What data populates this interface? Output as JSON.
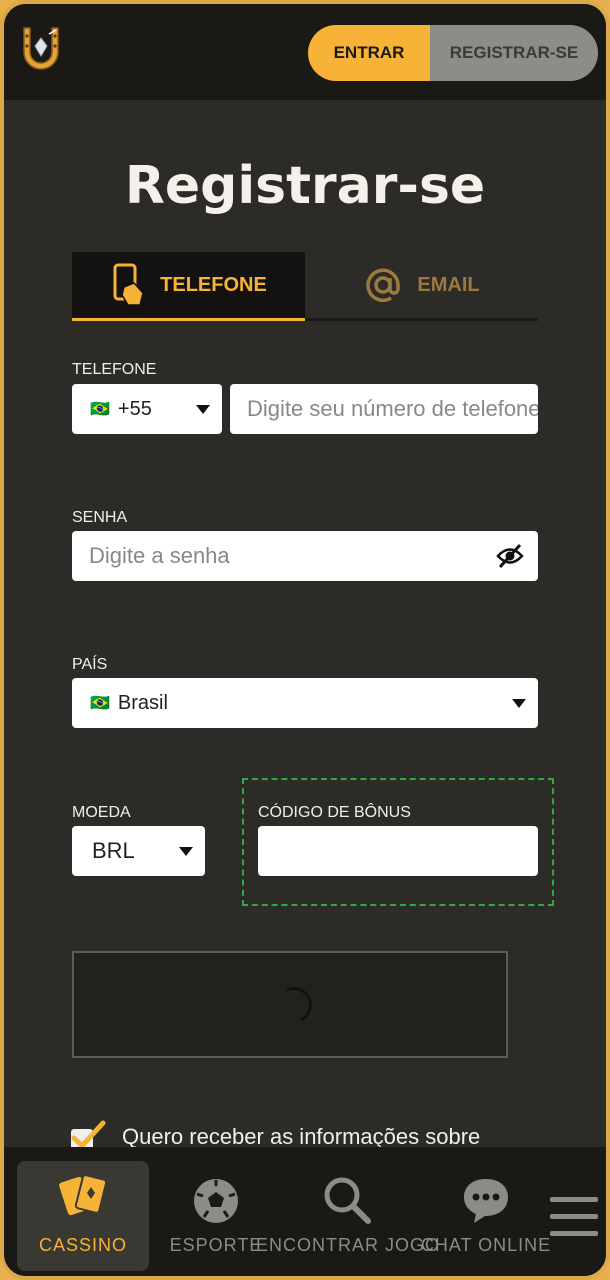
{
  "header": {
    "login_label": "ENTRAR",
    "register_label": "REGISTRAR-SE"
  },
  "page": {
    "title": "Registrar-se"
  },
  "tabs": [
    {
      "label": "TELEFONE",
      "icon": "phone-icon",
      "active": true
    },
    {
      "label": "EMAIL",
      "icon": "at-icon",
      "active": false
    }
  ],
  "form": {
    "phone_label": "TELEFONE",
    "phone_code": "+55",
    "phone_flag": "🇧🇷",
    "phone_placeholder": "Digite seu número de telefone",
    "password_label": "SENHA",
    "password_placeholder": "Digite a senha",
    "country_label": "PAÍS",
    "country_value": "Brasil",
    "country_flag": "🇧🇷",
    "currency_label": "MOEDA",
    "currency_value": "BRL",
    "bonus_label": "CÓDIGO DE BÔNUS",
    "bonus_value": "",
    "newsletter_text": "Quero receber as informações sobre",
    "newsletter_checked": true
  },
  "bottom_nav": [
    {
      "label": "CASSINO",
      "icon": "cards-icon",
      "active": true
    },
    {
      "label": "ESPORTE",
      "icon": "soccer-ball-icon",
      "active": false
    },
    {
      "label": "ENCONTRAR JOGO",
      "icon": "search-icon",
      "active": false
    },
    {
      "label": "CHAT ONLINE",
      "icon": "chat-icon",
      "active": false
    }
  ],
  "colors": {
    "accent": "#f6b337",
    "background": "#2d2b27",
    "bonus_border": "#2fa844"
  }
}
